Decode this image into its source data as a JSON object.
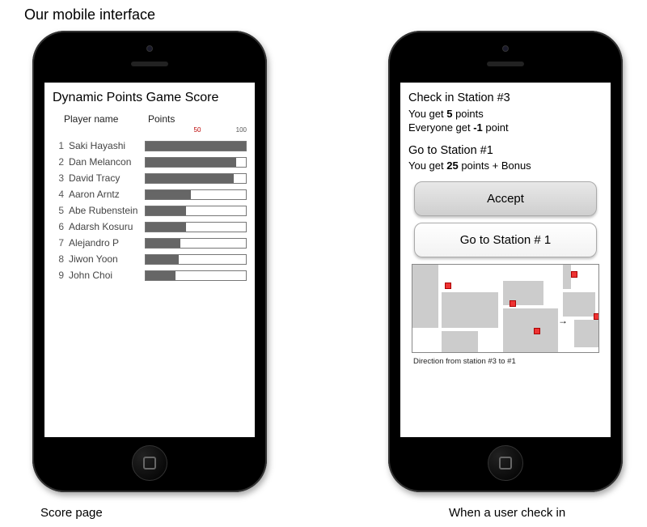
{
  "page_title": "Our mobile interface",
  "captions": {
    "left": "Score page",
    "right": "When a user check in"
  },
  "score": {
    "title": "Dynamic Points Game Score",
    "col_name": "Player name",
    "col_points": "Points",
    "scale": {
      "min": "",
      "mid": "50",
      "max": "100"
    },
    "players": [
      {
        "rank": "1",
        "name": "Saki Hayashi",
        "pts": 100
      },
      {
        "rank": "2",
        "name": "Dan Melancon",
        "pts": 90
      },
      {
        "rank": "3",
        "name": "David Tracy",
        "pts": 88
      },
      {
        "rank": "4",
        "name": "Aaron Arntz",
        "pts": 45
      },
      {
        "rank": "5",
        "name": "Abe Rubenstein",
        "pts": 40
      },
      {
        "rank": "6",
        "name": "Adarsh Kosuru",
        "pts": 40
      },
      {
        "rank": "7",
        "name": "Alejandro P",
        "pts": 35
      },
      {
        "rank": "8",
        "name": "Jiwon Yoon",
        "pts": 33
      },
      {
        "rank": "9",
        "name": "John Choi",
        "pts": 30
      }
    ]
  },
  "checkin": {
    "line1": "Check in Station #3",
    "line2_pre": "You get ",
    "line2_b": "5",
    "line2_post": " points",
    "line3_pre": "Everyone get ",
    "line3_b": "-1",
    "line3_post": " point",
    "go_h": "Go to Station #1",
    "go_sub_pre": "You get ",
    "go_sub_b": "25",
    "go_sub_post": " points + Bonus",
    "accept_label": "Accept",
    "goto_label": "Go to Station # 1",
    "map_caption": "Direction from station  #3 to #1"
  },
  "chart_data": {
    "type": "bar",
    "title": "Dynamic Points Game Score",
    "xlabel": "Points",
    "ylabel": "Player name",
    "xlim": [
      0,
      100
    ],
    "categories": [
      "Saki Hayashi",
      "Dan Melancon",
      "David Tracy",
      "Aaron Arntz",
      "Abe Rubenstein",
      "Adarsh Kosuru",
      "Alejandro P",
      "Jiwon Yoon",
      "John Choi"
    ],
    "values": [
      100,
      90,
      88,
      45,
      40,
      40,
      35,
      33,
      30
    ]
  }
}
